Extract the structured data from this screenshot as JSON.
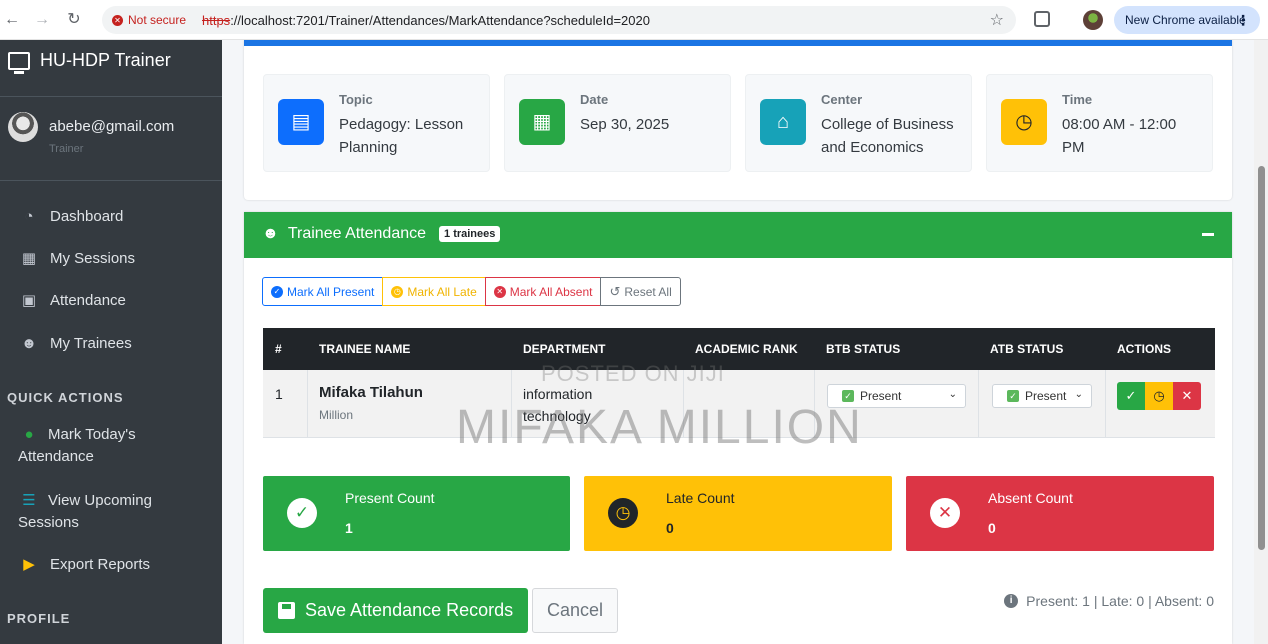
{
  "browser": {
    "security_label": "Not secure",
    "url_scheme": "https",
    "url_rest": "://localhost:7201/Trainer/Attendances/MarkAttendance?scheduleId=2020",
    "chrome_update_label": "New Chrome available"
  },
  "sidebar": {
    "brand": "HU-HDP Trainer",
    "user": {
      "email": "abebe@gmail.com",
      "role": "Trainer"
    },
    "nav": [
      {
        "label": "Dashboard",
        "icon": "dashboard-icon"
      },
      {
        "label": "My Sessions",
        "icon": "calendar-icon"
      },
      {
        "label": "Attendance",
        "icon": "clipboard-check-icon"
      },
      {
        "label": "My Trainees",
        "icon": "users-icon"
      }
    ],
    "quick_actions_label": "QUICK ACTIONS",
    "quick_actions": [
      {
        "label": "Mark Today's Attendance",
        "icon": "check-circle-icon"
      },
      {
        "label": "View Upcoming Sessions",
        "icon": "list-icon"
      },
      {
        "label": "Export Reports",
        "icon": "file-export-icon"
      }
    ],
    "profile_label": "PROFILE"
  },
  "session": {
    "topic": {
      "label": "Topic",
      "value": "Pedagogy: Lesson Planning",
      "color": "#0d6efd"
    },
    "date": {
      "label": "Date",
      "value": "Sep 30, 2025",
      "color": "#28a745"
    },
    "center": {
      "label": "Center",
      "value": "College of Business and Economics",
      "color": "#17a2b8"
    },
    "time": {
      "label": "Time",
      "value": "08:00 AM - 12:00 PM",
      "color": "#ffc107"
    }
  },
  "attendance": {
    "title": "Trainee Attendance",
    "badge": "1 trainees",
    "bulk_actions": {
      "present": "Mark All Present",
      "late": "Mark All Late",
      "absent": "Mark All Absent",
      "reset": "Reset All"
    },
    "columns": [
      "#",
      "TRAINEE NAME",
      "DEPARTMENT",
      "ACADEMIC RANK",
      "BTB STATUS",
      "ATB STATUS",
      "ACTIONS"
    ],
    "rows": [
      {
        "index": "1",
        "name": "Mifaka Tilahun",
        "subname": "Million",
        "department": "information technology",
        "academic_rank": "",
        "btb_status": "Present",
        "atb_status": "Present"
      }
    ],
    "counts": {
      "present": {
        "label": "Present Count",
        "value": "1",
        "color": "#28a745"
      },
      "late": {
        "label": "Late Count",
        "value": "0",
        "color": "#ffc107"
      },
      "absent": {
        "label": "Absent Count",
        "value": "0",
        "color": "#dc3545"
      }
    },
    "save_label": "Save Attendance Records",
    "cancel_label": "Cancel",
    "summary": "Present: 1 | Late: 0 | Absent: 0"
  },
  "watermark": {
    "line1": "POSTED ON JIJI",
    "line2": "MIFAKA MILLION"
  }
}
